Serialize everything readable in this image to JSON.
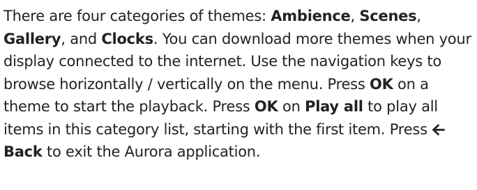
{
  "paragraph": {
    "s1_intro": "There are four categories of themes: ",
    "cat_ambience": "Ambience",
    "comma1": ", ",
    "cat_scenes": "Scenes",
    "comma2": ", ",
    "cat_gallery": "Gallery",
    "and_text": ", and ",
    "cat_clocks": "Clocks",
    "s1_end": ". You can download more themes when your display connected to the internet. Use the navigation keys to browse horizontally / vertically on the menu. Press ",
    "key_ok_1": "OK",
    "s3_mid": " on a theme to start the playback. Press ",
    "key_ok_2": "OK",
    "on_text": " on ",
    "play_all": "Play all",
    "s4_end": " to play all items in this category list, starting with the first item. Press ",
    "key_back": "Back",
    "s5_end": " to exit the Aurora application.",
    "arrow_icon": "left-arrow-icon"
  }
}
